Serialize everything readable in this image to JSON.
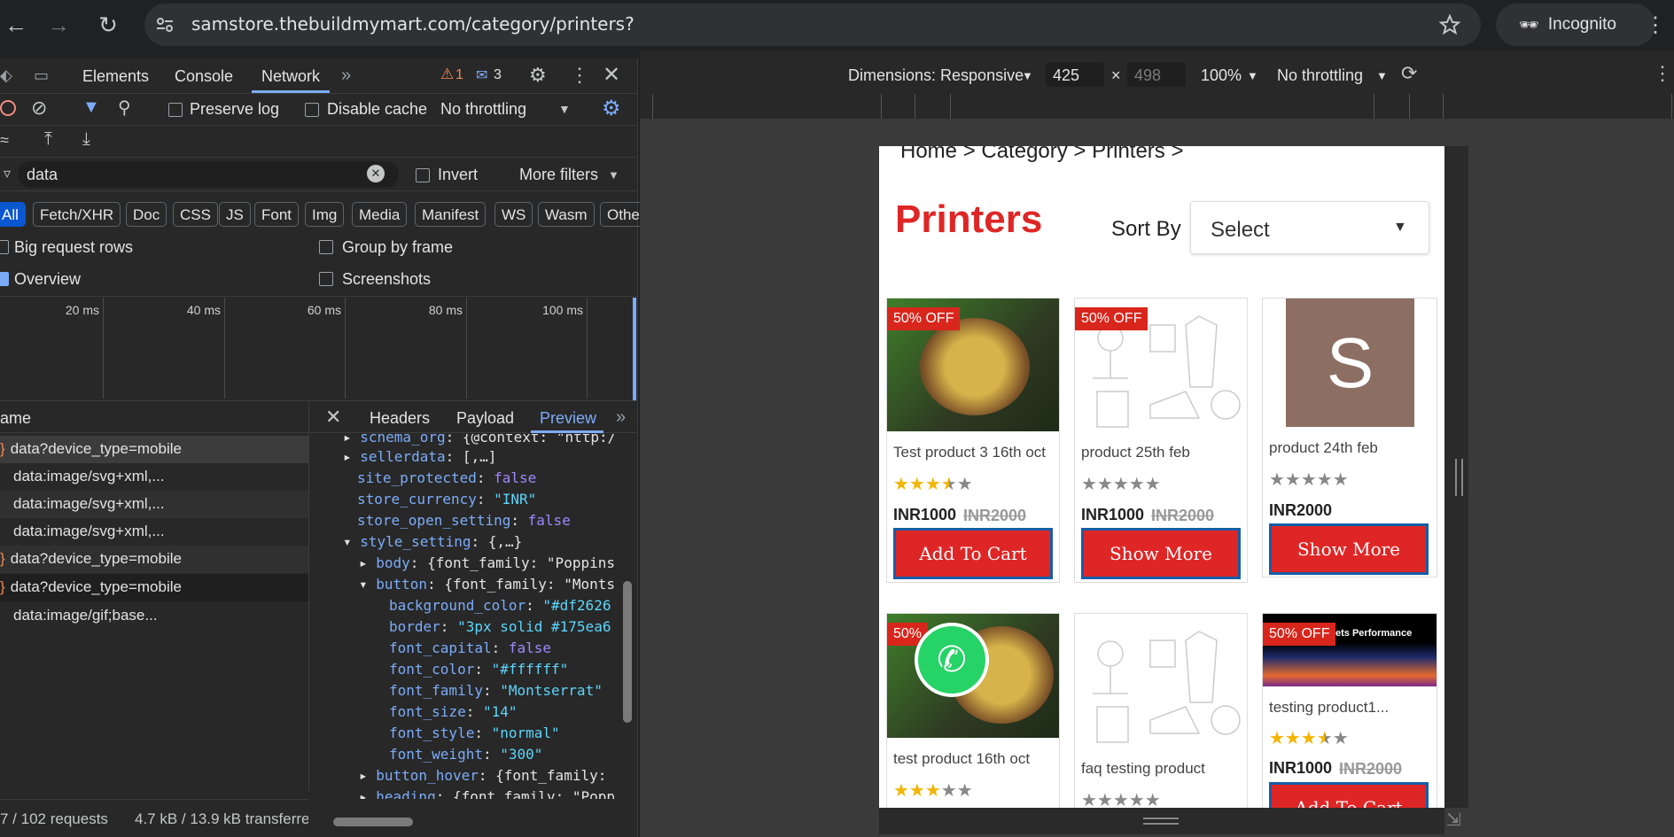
{
  "browser": {
    "url": "samstore.thebuildmymart.com/category/printers?",
    "incognito_label": "Incognito"
  },
  "devtools": {
    "tabs": [
      "Elements",
      "Console",
      "Network"
    ],
    "warnings_count": "1",
    "messages_count": "3",
    "toolbar": {
      "preserve_log": "Preserve log",
      "disable_cache": "Disable cache",
      "throttling": "No throttling"
    },
    "filter": {
      "value": "data",
      "invert": "Invert",
      "more_filters": "More filters"
    },
    "type_filters": [
      "All",
      "Fetch/XHR",
      "Doc",
      "CSS",
      "JS",
      "Font",
      "Img",
      "Media",
      "Manifest",
      "WS",
      "Wasm",
      "Othe"
    ],
    "options": {
      "big_rows": "Big request rows",
      "group_by_frame": "Group by frame",
      "overview": "Overview",
      "screenshots": "Screenshots"
    },
    "timeline_ticks": [
      "20 ms",
      "40 ms",
      "60 ms",
      "80 ms",
      "100 ms"
    ],
    "requests_header": "ame",
    "requests": [
      "data?device_type=mobile",
      "data:image/svg+xml,...",
      "data:image/svg+xml,...",
      "data:image/svg+xml,...",
      "data?device_type=mobile",
      "data?device_type=mobile",
      "data:image/gif;base..."
    ],
    "detail_tabs": [
      "Headers",
      "Payload",
      "Preview"
    ],
    "preview_lines": [
      {
        "key": "schema_org",
        "val": "{@context: \"http:/"
      },
      {
        "key": "sellerdata",
        "val": "[,…]"
      },
      {
        "key": "site_protected",
        "val": "false"
      },
      {
        "key": "store_currency",
        "val": "\"INR\""
      },
      {
        "key": "store_open_setting",
        "val": "false"
      },
      {
        "key": "style_setting",
        "val": "{,…}"
      },
      {
        "key": "body",
        "val": "{font_family: \"Poppins"
      },
      {
        "key": "button",
        "val": "{font_family: \"Monts"
      },
      {
        "key": "background_color",
        "val": "\"#df2626"
      },
      {
        "key": "border",
        "val": "\"3px solid #175ea6"
      },
      {
        "key": "font_capital",
        "val": "false"
      },
      {
        "key": "font_color",
        "val": "\"#ffffff\""
      },
      {
        "key": "font_family",
        "val": "\"Montserrat\""
      },
      {
        "key": "font_size",
        "val": "\"14\""
      },
      {
        "key": "font_style",
        "val": "\"normal\""
      },
      {
        "key": "font_weight",
        "val": "\"300\""
      },
      {
        "key": "button_hover",
        "val": "{font_family:"
      },
      {
        "key": "heading",
        "val": "{font_family: \"Popp"
      }
    ],
    "status": {
      "requests": "7 / 102 requests",
      "transferred": "4.7 kB / 13.9 kB transferre"
    }
  },
  "emulator": {
    "dimensions_label": "Dimensions: Responsive",
    "width": "425",
    "height": "498",
    "zoom": "100%",
    "throttling": "No throttling"
  },
  "site": {
    "breadcrumb": "Home > Category > Printers >",
    "title": "Printers",
    "sort_label": "Sort By",
    "sort_value": "Select",
    "products": [
      {
        "name": "Test product 3 16th oct",
        "badge": "50% OFF",
        "rating": 3.5,
        "price": "INR1000",
        "old_price": "INR2000",
        "button": "Add To Cart"
      },
      {
        "name": "product 25th feb",
        "badge": "50% OFF",
        "rating": 0,
        "price": "INR1000",
        "old_price": "INR2000",
        "button": "Show More"
      },
      {
        "name": "product 24th feb",
        "badge": "",
        "initial": "S",
        "rating": 0,
        "price": "INR2000",
        "old_price": "",
        "button": "Show More"
      },
      {
        "name": "test product 16th oct",
        "badge": "50%",
        "rating": 3,
        "price": "",
        "old_price": "",
        "button": ""
      },
      {
        "name": "faq testing product",
        "badge": "",
        "rating": 0,
        "price": "",
        "old_price": "",
        "button": ""
      },
      {
        "name": "testing product1...",
        "badge": "50% OFF",
        "banner_text": "ets Performance",
        "rating": 3.5,
        "price": "INR1000",
        "old_price": "INR2000",
        "button": "Add To Cart"
      }
    ]
  },
  "colors": {
    "accent_red": "#df2626",
    "button_border": "#175ea6",
    "devtools_bg": "#282828",
    "link_blue": "#7cacf8"
  }
}
